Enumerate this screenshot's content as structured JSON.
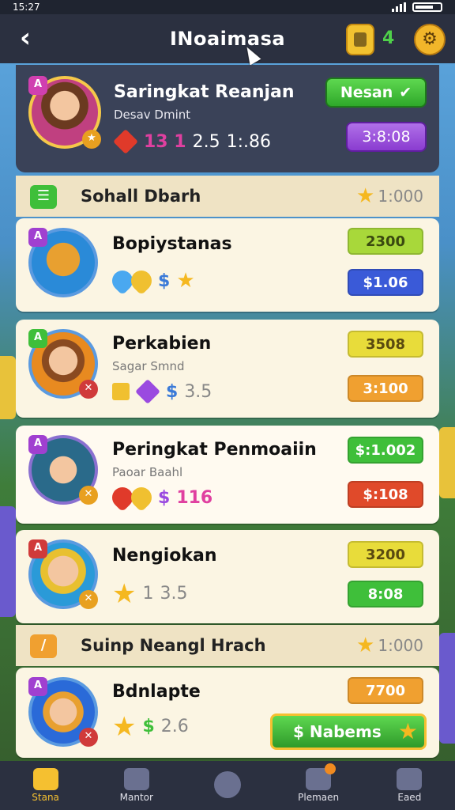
{
  "status_bar": {
    "time": "15:27"
  },
  "header": {
    "title": "INoaimasa",
    "count": "4"
  },
  "profile": {
    "name": "Saringkat Reanjan",
    "subtitle": "Desav Dmint",
    "stat_a": "13 1",
    "stat_b": "2.5",
    "stat_c": "1:.86",
    "btn_green": "Nesan",
    "btn_purple": "3:8:08"
  },
  "sections": [
    {
      "title": "Sohall Dbarh",
      "value": "1:000"
    },
    {
      "title": "Suinp Neangl Hrach",
      "value": "1:000"
    }
  ],
  "rows": [
    {
      "name": "Bopiystanas",
      "subtitle": "",
      "currency": "$",
      "tag1": "2300",
      "tag2": "$1.06"
    },
    {
      "name": "Perkabien",
      "subtitle": "Sagar Smnd",
      "currency": "$",
      "stat": "3.5",
      "tag1": "3508",
      "tag2": "3:100"
    },
    {
      "name": "Peringkat Penmoaiin",
      "subtitle": "Paoar Baahl",
      "currency": "$",
      "stat": "116",
      "tag1": "$:1.002",
      "tag2": "$:108"
    },
    {
      "name": "Nengiokan",
      "subtitle": "",
      "stat_a": "1",
      "stat_b": "3.5",
      "tag1": "3200",
      "tag2": "8:08"
    },
    {
      "name": "Bdnlapte",
      "subtitle": "",
      "currency": "$",
      "stat": "2.6",
      "tag1": "7700"
    }
  ],
  "buy_button": {
    "label": "$ Nabems"
  },
  "nav": [
    {
      "label": "Stana"
    },
    {
      "label": "Mantor"
    },
    {
      "label": ""
    },
    {
      "label": "Plemaen"
    },
    {
      "label": "Eaed"
    }
  ],
  "colors": {
    "green": "#3fbf3a",
    "purple": "#9a4ae0",
    "yellow": "#e8dc3a",
    "orange": "#f0a030",
    "red": "#e04a2a",
    "blue": "#3a5ad8",
    "lime": "#a8d83a"
  }
}
